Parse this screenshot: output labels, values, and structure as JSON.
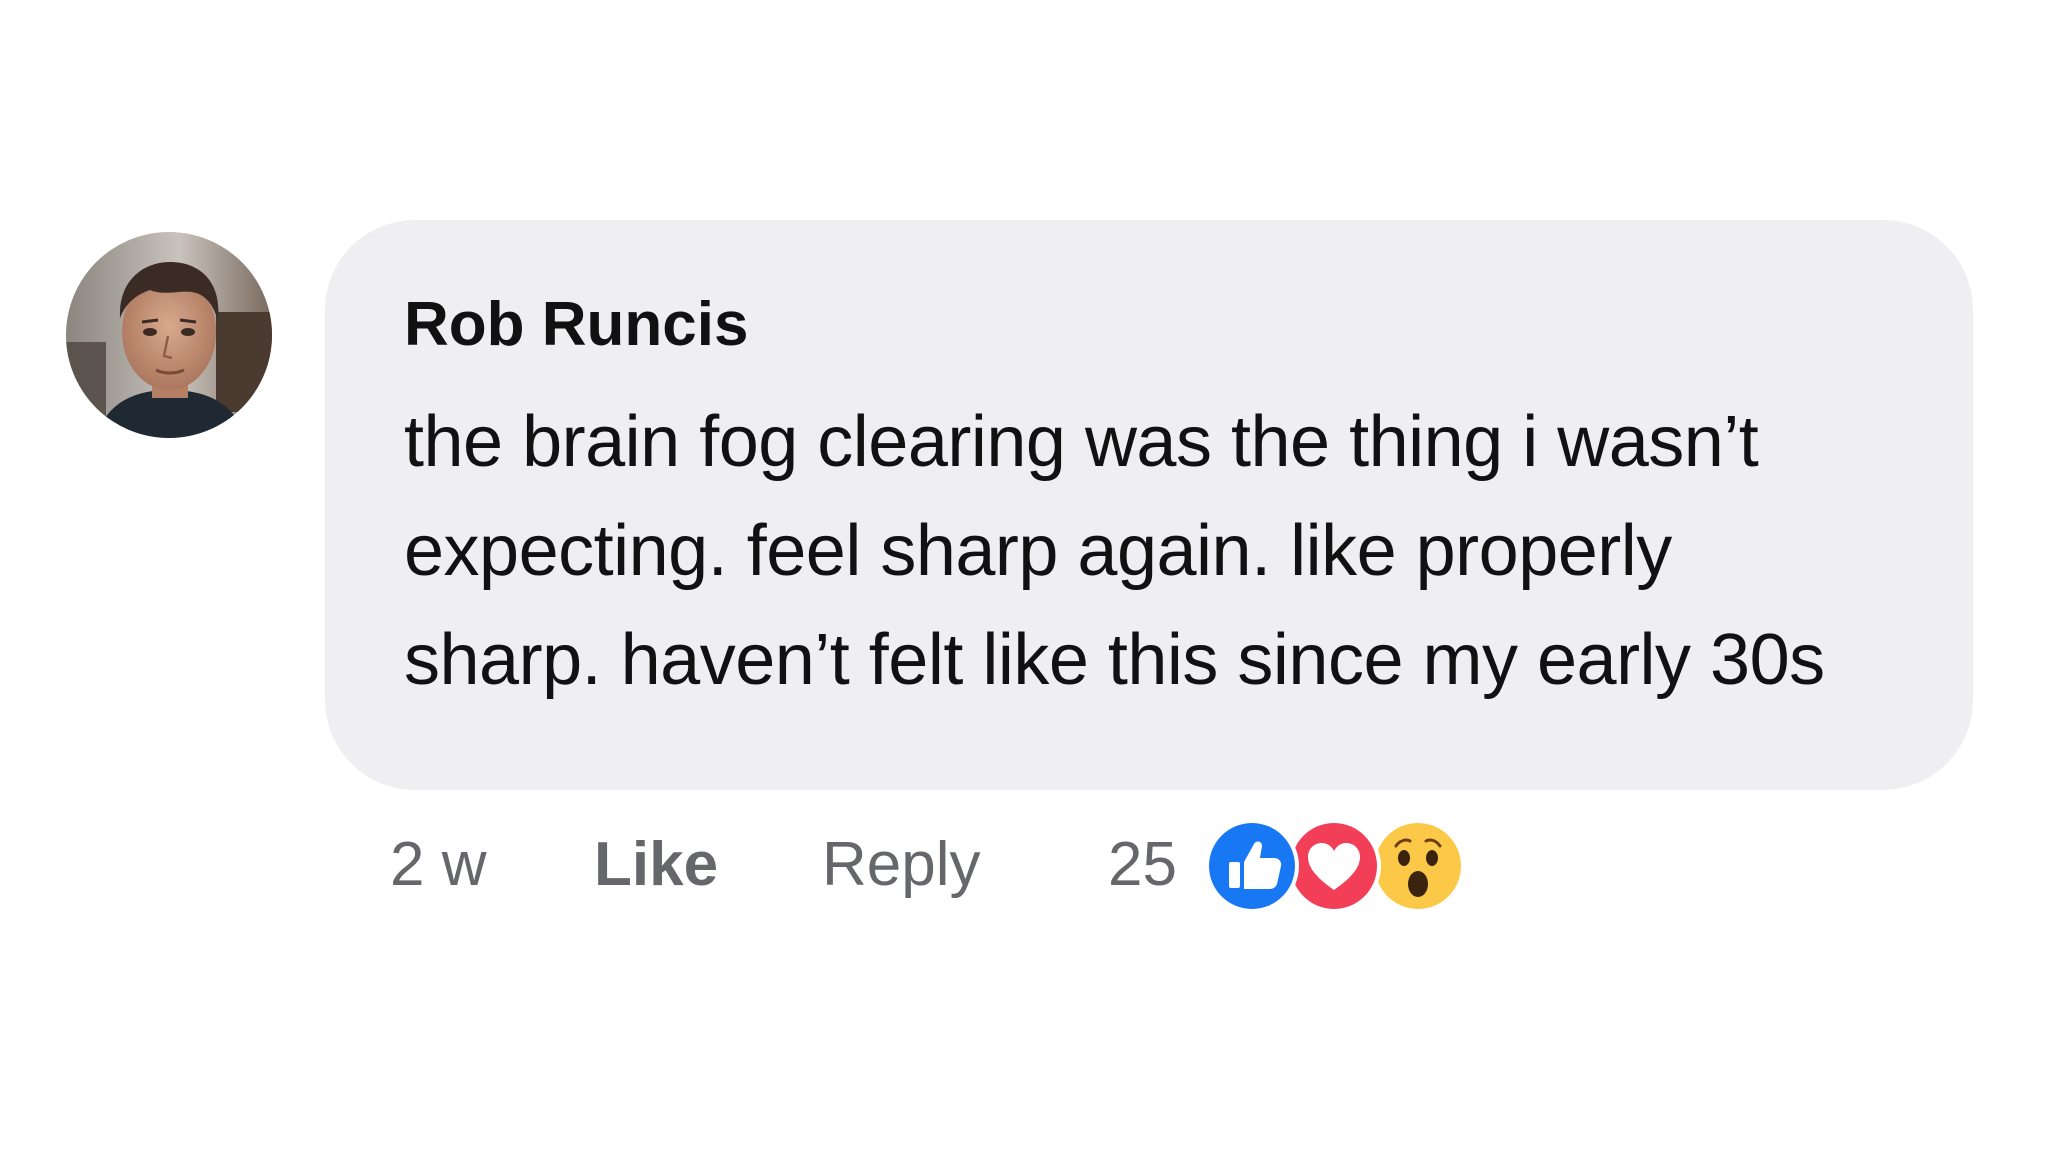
{
  "comment": {
    "author": "Rob Runcis",
    "text_lines": [
      "the brain fog clearing was the thing i wasn’t",
      "expecting. feel sharp again. like properly",
      "sharp. haven’t felt like this since my early 30s"
    ]
  },
  "actions": {
    "time": "2 w",
    "like_label": "Like",
    "reply_label": "Reply",
    "reaction_count": "25"
  },
  "reactions": [
    {
      "icon": "thumbs-up-icon",
      "color": "#1877f2"
    },
    {
      "icon": "heart-icon",
      "color": "#f33e58"
    },
    {
      "icon": "wow-face-icon",
      "color": "#fcc847"
    }
  ],
  "colors": {
    "bubble": "#efeff2",
    "text": "#111111",
    "meta": "#65676b"
  }
}
